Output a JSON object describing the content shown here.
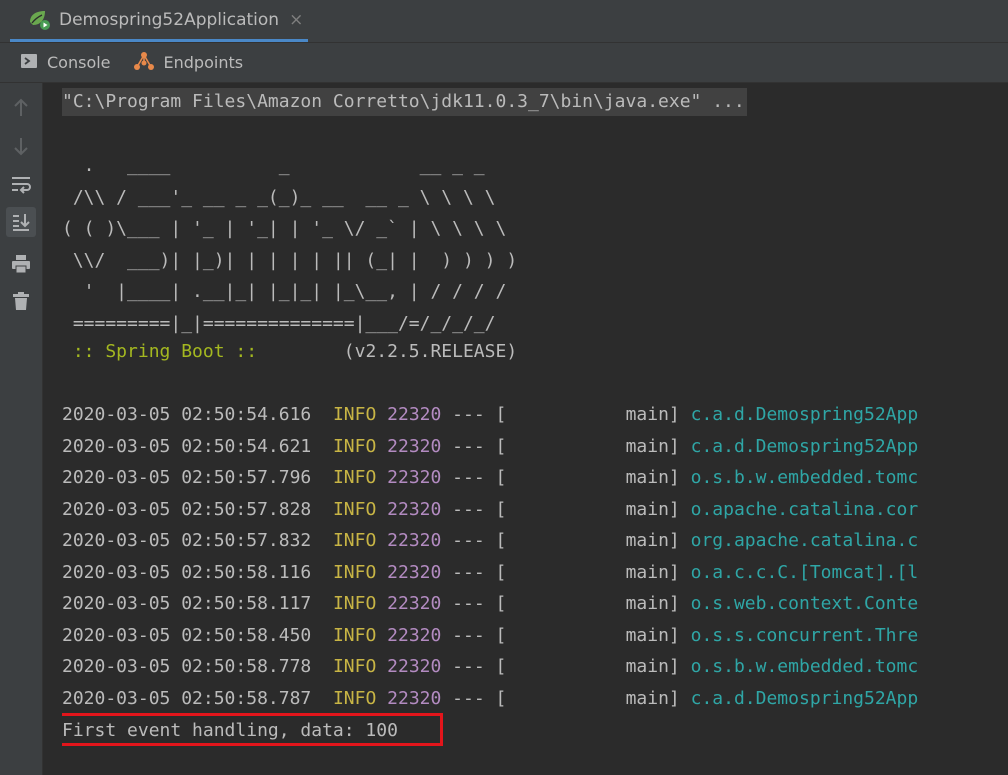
{
  "run_tab": {
    "title": "Demospring52Application",
    "close_glyph": "×",
    "icon": "spring-run-icon"
  },
  "subtabs": [
    {
      "label": "Console",
      "icon": "console-icon"
    },
    {
      "label": "Endpoints",
      "icon": "endpoints-icon"
    }
  ],
  "gutter_icons": [
    "up-arrow-icon",
    "down-arrow-icon",
    "soft-wrap-icon",
    "scroll-to-end-icon",
    "print-icon",
    "trash-icon"
  ],
  "console": {
    "command": "\"C:\\Program Files\\Amazon Corretto\\jdk11.0.3_7\\bin\\java.exe\" ...",
    "banner": "  .   ____          _            __ _ _\n /\\\\ / ___'_ __ _ _(_)_ __  __ _ \\ \\ \\ \\\n( ( )\\___ | '_ | '_| | '_ \\/ _` | \\ \\ \\ \\\n \\\\/  ___)| |_)| | | | | || (_| |  ) ) ) )\n  '  |____| .__|_| |_|_| |_\\__, | / / / /\n =========|_|==============|___/=/_/_/_/",
    "spring_label": " :: Spring Boot :: ",
    "spring_version": "       (v2.2.5.RELEASE)",
    "logs": [
      {
        "ts": "2020-03-05 02:50:54.616",
        "level": "INFO",
        "pid": "22320",
        "sep": "---",
        "thread": "[           main]",
        "logger": "c.a.d.Demospring52App"
      },
      {
        "ts": "2020-03-05 02:50:54.621",
        "level": "INFO",
        "pid": "22320",
        "sep": "---",
        "thread": "[           main]",
        "logger": "c.a.d.Demospring52App"
      },
      {
        "ts": "2020-03-05 02:50:57.796",
        "level": "INFO",
        "pid": "22320",
        "sep": "---",
        "thread": "[           main]",
        "logger": "o.s.b.w.embedded.tomc"
      },
      {
        "ts": "2020-03-05 02:50:57.828",
        "level": "INFO",
        "pid": "22320",
        "sep": "---",
        "thread": "[           main]",
        "logger": "o.apache.catalina.cor"
      },
      {
        "ts": "2020-03-05 02:50:57.832",
        "level": "INFO",
        "pid": "22320",
        "sep": "---",
        "thread": "[           main]",
        "logger": "org.apache.catalina.c"
      },
      {
        "ts": "2020-03-05 02:50:58.116",
        "level": "INFO",
        "pid": "22320",
        "sep": "---",
        "thread": "[           main]",
        "logger": "o.a.c.c.C.[Tomcat].[l"
      },
      {
        "ts": "2020-03-05 02:50:58.117",
        "level": "INFO",
        "pid": "22320",
        "sep": "---",
        "thread": "[           main]",
        "logger": "o.s.web.context.Conte"
      },
      {
        "ts": "2020-03-05 02:50:58.450",
        "level": "INFO",
        "pid": "22320",
        "sep": "---",
        "thread": "[           main]",
        "logger": "o.s.s.concurrent.Thre"
      },
      {
        "ts": "2020-03-05 02:50:58.778",
        "level": "INFO",
        "pid": "22320",
        "sep": "---",
        "thread": "[           main]",
        "logger": "o.s.b.w.embedded.tomc"
      },
      {
        "ts": "2020-03-05 02:50:58.787",
        "level": "INFO",
        "pid": "22320",
        "sep": "---",
        "thread": "[           main]",
        "logger": "c.a.d.Demospring52App"
      }
    ],
    "event_line": "First event handling, data: 100"
  },
  "colors": {
    "accent_tab_underline": "#4a88c7",
    "log_level": "#c8b545",
    "log_pid": "#b38bc1",
    "log_logger": "#2fa6a6",
    "spring_boot": "#a4b820",
    "highlight_box": "#e3151b"
  }
}
